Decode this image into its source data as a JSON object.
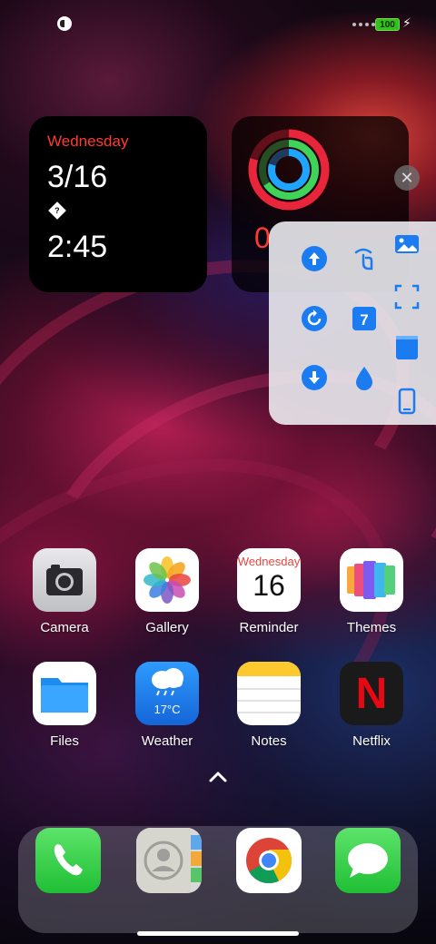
{
  "status": {
    "battery_level": "100",
    "charging_icon": "bolt-icon"
  },
  "widgets": {
    "date": {
      "weekday": "Wednesday",
      "date": "3/16",
      "glyph": "?",
      "time": "2:45"
    },
    "activity": {
      "value": "0",
      "ring_colors": [
        "#e8253a",
        "#3fd35a",
        "#1fa4ff"
      ]
    }
  },
  "side_panel": {
    "tools": [
      "upload-icon",
      "touch-gesture-icon",
      "image-icon",
      "screenshot-frame-icon",
      "rotate-icon",
      "calendar-icon",
      "note-icon",
      "download-icon",
      "water-drop-icon",
      "phone-icon"
    ],
    "calendar_day": "7",
    "accent_color": "#1a7cf0"
  },
  "apps": {
    "row1": [
      {
        "label": "Camera"
      },
      {
        "label": "Gallery"
      },
      {
        "label": "Reminder",
        "icon_weekday": "Wednesday",
        "icon_day": "16"
      },
      {
        "label": "Themes"
      }
    ],
    "row2": [
      {
        "label": "Files"
      },
      {
        "label": "Weather",
        "icon_temp": "17°C"
      },
      {
        "label": "Notes"
      },
      {
        "label": "Netflix",
        "icon_letter": "N"
      }
    ]
  },
  "dock": {
    "apps": [
      "phone-app",
      "contacts-app",
      "chrome-app",
      "messages-app"
    ]
  }
}
